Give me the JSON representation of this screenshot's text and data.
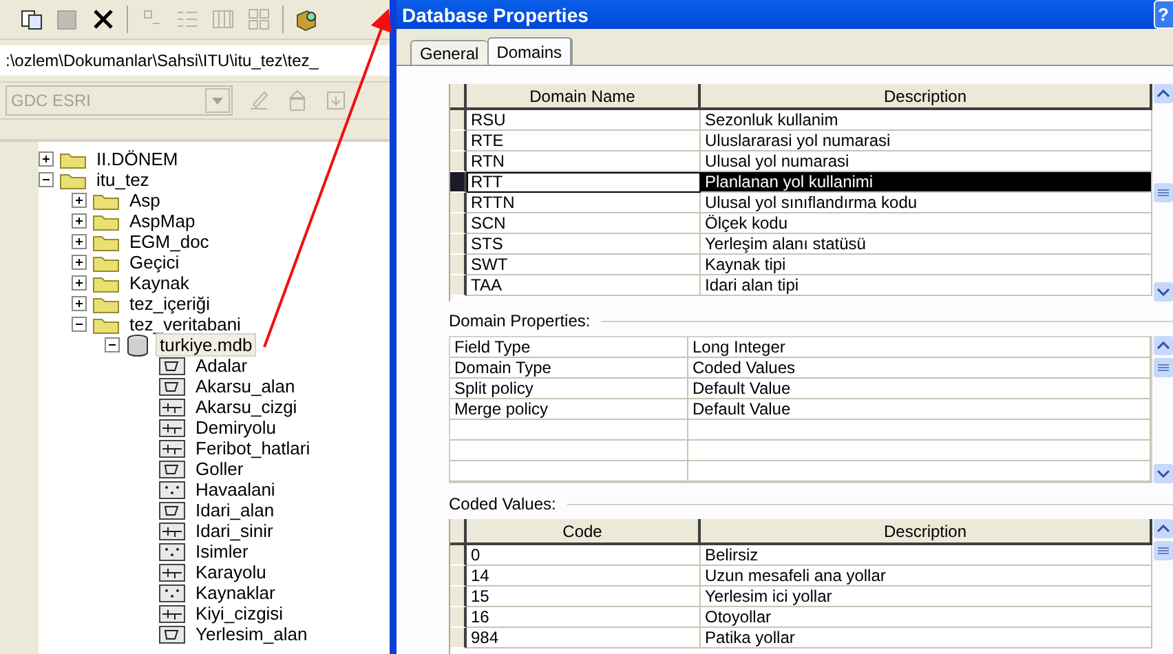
{
  "catalog": {
    "path": ":\\ozlem\\Dokumanlar\\Sahsi\\ITU\\itu_tez\\tez_",
    "style_combo": {
      "value": "GDC ESRI",
      "disabled": true
    },
    "tree": [
      {
        "label": "II.DÖNEM",
        "kind": "folder",
        "expanded": false
      },
      {
        "label": "itu_tez",
        "kind": "folder",
        "expanded": true,
        "children": [
          {
            "label": "Asp",
            "kind": "folder",
            "expanded": false
          },
          {
            "label": "AspMap",
            "kind": "folder",
            "expanded": false
          },
          {
            "label": "EGM_doc",
            "kind": "folder",
            "expanded": false
          },
          {
            "label": "Geçici",
            "kind": "folder",
            "expanded": false
          },
          {
            "label": "Kaynak",
            "kind": "folder",
            "expanded": false
          },
          {
            "label": "tez_içeriği",
            "kind": "folder",
            "expanded": false
          },
          {
            "label": "tez_veritabani",
            "kind": "folder",
            "expanded": true,
            "children": [
              {
                "label": "turkiye.mdb",
                "kind": "database",
                "expanded": true,
                "selected": true,
                "children": [
                  {
                    "label": "Adalar",
                    "kind": "polygon",
                    "selected": false
                  },
                  {
                    "label": "Akarsu_alan",
                    "kind": "polygon",
                    "selected": false
                  },
                  {
                    "label": "Akarsu_cizgi",
                    "kind": "line",
                    "selected": false
                  },
                  {
                    "label": "Demiryolu",
                    "kind": "line",
                    "selected": false
                  },
                  {
                    "label": "Feribot_hatlari",
                    "kind": "line",
                    "selected": false
                  },
                  {
                    "label": "Goller",
                    "kind": "polygon",
                    "selected": false
                  },
                  {
                    "label": "Havaalani",
                    "kind": "point",
                    "selected": false
                  },
                  {
                    "label": "Idari_alan",
                    "kind": "polygon",
                    "selected": false
                  },
                  {
                    "label": "Idari_sinir",
                    "kind": "line",
                    "selected": false
                  },
                  {
                    "label": "Isimler",
                    "kind": "point",
                    "selected": false
                  },
                  {
                    "label": "Karayolu",
                    "kind": "line",
                    "selected": false
                  },
                  {
                    "label": "Kaynaklar",
                    "kind": "point",
                    "selected": false
                  },
                  {
                    "label": "Kiyi_cizgisi",
                    "kind": "line",
                    "selected": false
                  },
                  {
                    "label": "Yerlesim_alan",
                    "kind": "polygon",
                    "selected": false
                  }
                ]
              }
            ]
          }
        ]
      }
    ]
  },
  "dialog": {
    "title": "Database Properties",
    "help_button": "?",
    "tabs": [
      {
        "label": "General",
        "selected": false
      },
      {
        "label": "Domains",
        "selected": true
      }
    ],
    "domains": {
      "columns": [
        "Domain Name",
        "Description"
      ],
      "rows": [
        {
          "name": "RSU",
          "description": "Sezonluk kullanim",
          "selected": false
        },
        {
          "name": "RTE",
          "description": "Uluslararasi yol numarasi",
          "selected": false
        },
        {
          "name": "RTN",
          "description": "Ulusal yol numarasi",
          "selected": false
        },
        {
          "name": "RTT",
          "description": "Planlanan yol kullanimi",
          "selected": true
        },
        {
          "name": "RTTN",
          "description": "Ulusal yol sınıflandırma kodu",
          "selected": false
        },
        {
          "name": "SCN",
          "description": "Ölçek kodu",
          "selected": false
        },
        {
          "name": "STS",
          "description": "Yerleşim alanı statüsü",
          "selected": false
        },
        {
          "name": "SWT",
          "description": "Kaynak tipi",
          "selected": false
        },
        {
          "name": "TAA",
          "description": "Idari alan tipi",
          "selected": false
        }
      ]
    },
    "domain_properties": {
      "label": "Domain Properties:",
      "rows": [
        {
          "property": "Field Type",
          "value": "Long Integer"
        },
        {
          "property": "Domain Type",
          "value": "Coded Values"
        },
        {
          "property": "Split policy",
          "value": "Default Value"
        },
        {
          "property": "Merge policy",
          "value": "Default Value"
        }
      ]
    },
    "coded_values": {
      "label": "Coded Values:",
      "columns": [
        "Code",
        "Description"
      ],
      "rows": [
        {
          "code": "0",
          "description": "Belirsiz"
        },
        {
          "code": "14",
          "description": "Uzun mesafeli ana yollar"
        },
        {
          "code": "15",
          "description": "Yerlesim ici yollar"
        },
        {
          "code": "16",
          "description": "Otoyollar"
        },
        {
          "code": "984",
          "description": "Patika yollar"
        }
      ]
    }
  }
}
